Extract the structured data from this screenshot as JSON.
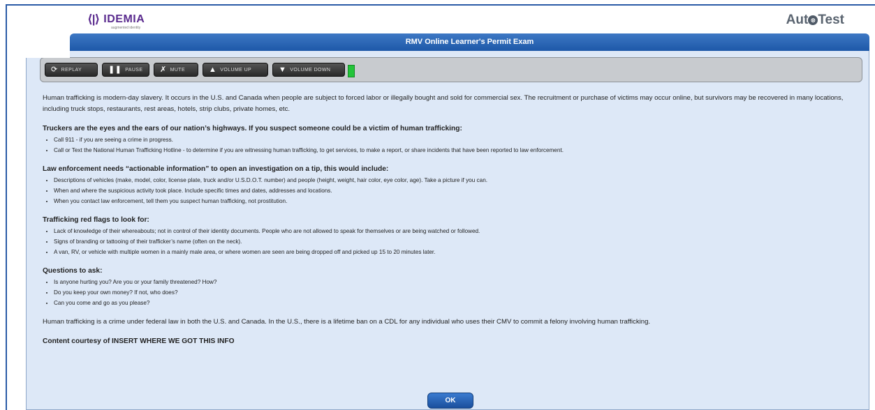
{
  "header": {
    "brand_mark": "⟨|⟩",
    "brand_name": "IDEMIA",
    "brand_tagline": "augmented identity",
    "product_prefix": "Aut",
    "product_mark": "⊗",
    "product_suffix": "Test",
    "exam_title": "RMV Online Learner's Permit Exam"
  },
  "toolbar": {
    "replay_label": "REPLAY",
    "pause_label": "PAUSE",
    "mute_label": "MUTE",
    "volume_up_label": "VOLUME UP",
    "volume_down_label": "VOLUME DOWN",
    "icons": {
      "replay": "⟳",
      "pause": "❚❚",
      "mute": "✗",
      "volume_up": "▲",
      "volume_down": "▼"
    },
    "volume_indicator_color": "#23c43a"
  },
  "content": {
    "intro": "Human trafficking is modern-day slavery. It occurs in the U.S. and Canada when people are subject to forced labor or illegally bought and sold for commercial sex. The recruitment or purchase of victims may occur online, but survivors may be recovered in many locations, including truck stops, restaurants, rest areas, hotels, strip clubs, private homes, etc.",
    "sections": [
      {
        "heading": "Truckers are the eyes and the ears of our nation’s highways. If you suspect someone could be a victim of human trafficking:",
        "items": [
          "Call 911 - if you are seeing a crime in progress.",
          "Call or Text the National Human Trafficking Hotline - to determine if you are witnessing human trafficking, to get services, to make a report, or share incidents that have been reported to law enforcement."
        ]
      },
      {
        "heading": "Law enforcement needs “actionable information” to open an investigation on a tip, this would include:",
        "items": [
          "Descriptions of vehicles (make, model, color, license plate, truck and/or U.S.D.O.T. number) and people (height, weight, hair color, eye color, age). Take a picture if you can.",
          "When and where the suspicious activity took place. Include specific times and dates, addresses and locations.",
          "When you contact law enforcement, tell them you suspect human trafficking, not prostitution."
        ]
      },
      {
        "heading": "Trafficking red flags to look for:",
        "items": [
          "Lack of knowledge of their whereabouts; not in control of their identity documents. People who are not allowed to speak for themselves or are being watched or followed.",
          "Signs of branding or tattooing of their trafficker’s name (often on the neck).",
          "A van, RV, or vehicle with multiple women in a mainly male area, or where women are seen are being dropped off and picked up 15 to 20 minutes later."
        ]
      },
      {
        "heading": "Questions to ask:",
        "items": [
          "Is anyone hurting you? Are you or your family threatened? How?",
          "Do you keep your own money? If not, who does?",
          "Can you come and go as you please?"
        ]
      }
    ],
    "closing": "Human trafficking is a crime under federal law in both the U.S. and Canada. In the U.S., there is a lifetime ban on a CDL for any individual who uses their CMV to commit a felony involving human trafficking.",
    "credit": "Content courtesy of INSERT WHERE WE GOT THIS INFO"
  },
  "footer": {
    "ok_label": "OK"
  }
}
